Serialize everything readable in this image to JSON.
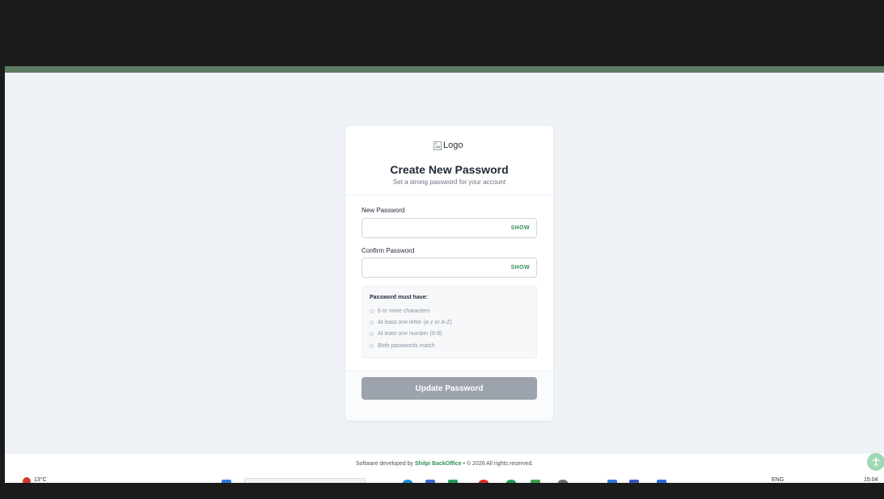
{
  "card": {
    "logo_alt": "Logo",
    "title": "Create New Password",
    "subtitle": "Set a strong password for your account"
  },
  "form": {
    "new_password": {
      "label": "New Password",
      "value": "",
      "show_label": "SHOW"
    },
    "confirm_password": {
      "label": "Confirm Password",
      "value": "",
      "show_label": "SHOW"
    },
    "rules": {
      "title": "Password must have:",
      "items": [
        "6 or more characters",
        "At least one letter (a-z or A-Z)",
        "At least one number (0-9)",
        "Both passwords match"
      ]
    },
    "submit_label": "Update Password"
  },
  "footer": {
    "prefix": "Software developed by",
    "brand": "Shilpi BackOffice",
    "separator": "•",
    "copyright": "© 2026 All rights reserved."
  },
  "taskbar": {
    "weather": "13°C",
    "language": "ENG",
    "time": "15:04"
  },
  "colors": {
    "accent_bar": "#5f7a62",
    "brand_green": "#2f8f56",
    "button_disabled": "#9ca3ad",
    "page_bg": "#eef1f5"
  }
}
